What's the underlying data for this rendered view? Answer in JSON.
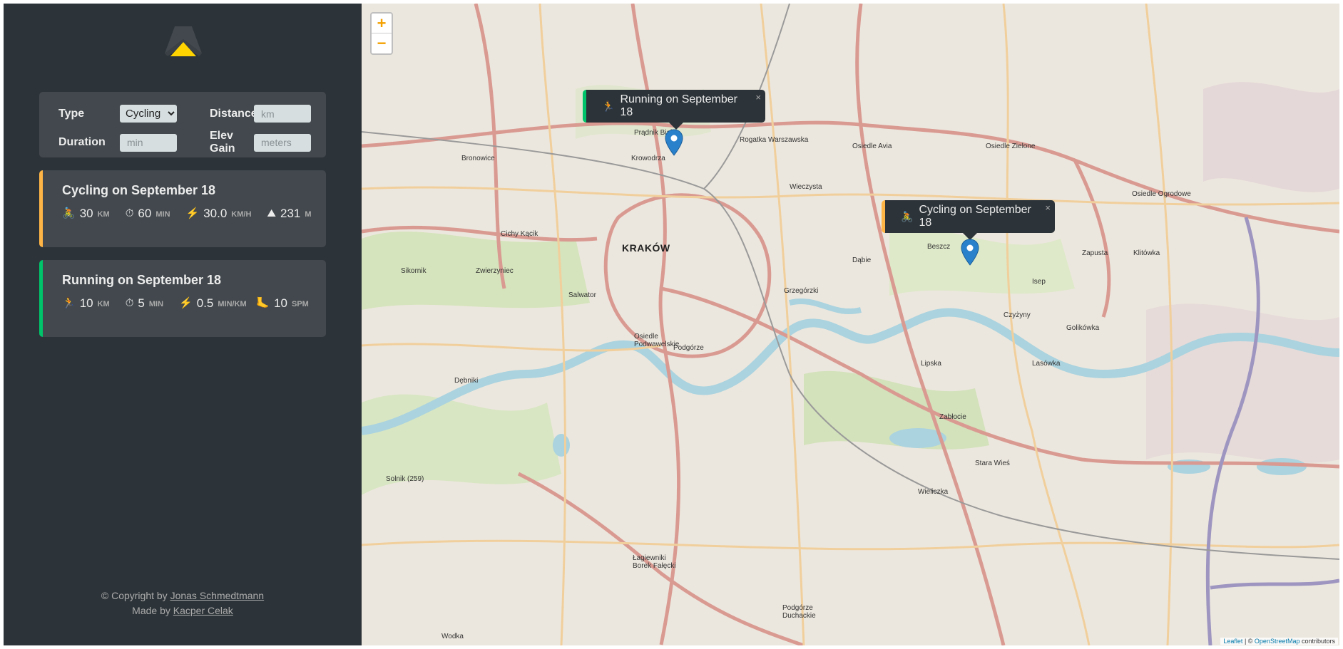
{
  "form": {
    "type_label": "Type",
    "type_value": "Cycling",
    "distance_label": "Distance",
    "distance_placeholder": "km",
    "duration_label": "Duration",
    "duration_placeholder": "min",
    "elev_label": "Elev Gain",
    "elev_placeholder": "meters"
  },
  "workouts": [
    {
      "title": "Cycling on September 18",
      "color": "#ffb545",
      "distance": "30",
      "distance_unit": "KM",
      "duration": "60",
      "duration_unit": "MIN",
      "speed": "30.0",
      "speed_unit": "KM/H",
      "elev": "231",
      "elev_unit": "M",
      "icon_type": "cyclist-icon"
    },
    {
      "title": "Running on September 18",
      "color": "#00c46a",
      "distance": "10",
      "distance_unit": "KM",
      "duration": "5",
      "duration_unit": "MIN",
      "pace": "0.5",
      "pace_unit": "MIN/KM",
      "cadence": "10",
      "cadence_unit": "SPM",
      "icon_type": "runner-icon"
    }
  ],
  "footer": {
    "copyright_prefix": "© Copyright by",
    "copyright_name": "Jonas Schmedtmann",
    "made_prefix": "Made by",
    "made_name": "Kacper Celak"
  },
  "map": {
    "zoom_in": "+",
    "zoom_out": "−",
    "city_label": "KRAKÓW",
    "popups": [
      {
        "text": "Running on September 18",
        "close": "×"
      },
      {
        "text": "Cycling on September 18",
        "close": "×"
      }
    ],
    "attribution": {
      "leaflet": "Leaflet",
      "sep": " | © ",
      "osm": "OpenStreetMap",
      "contrib": " contributors"
    },
    "labels": [
      "Prądnik Biały",
      "Krowodrza",
      "Bronowice",
      "Rogatka Warszawska",
      "Cichy Kącik",
      "Zwierzyniec",
      "Salwator",
      "Sikornik",
      "Dąbie",
      "Beszcz",
      "Grzegórzki",
      "Podgórze",
      "Osiedle Podwawelskie",
      "Dębniki",
      "Lipska",
      "Lasówka",
      "Zabłocie",
      "Stara Wieś",
      "Wieliczka",
      "Isep",
      "Zapusta",
      "Klitówka",
      "Golikówka",
      "Osiedle Avia",
      "Osiedle Zielone",
      "Wieczysta",
      "Czyżyny",
      "Osiedle Ogrodowe",
      "Łagiewniki Borek Fałęcki",
      "Podgórze Duchackie",
      "Solnik (259)",
      "Wodka"
    ]
  }
}
